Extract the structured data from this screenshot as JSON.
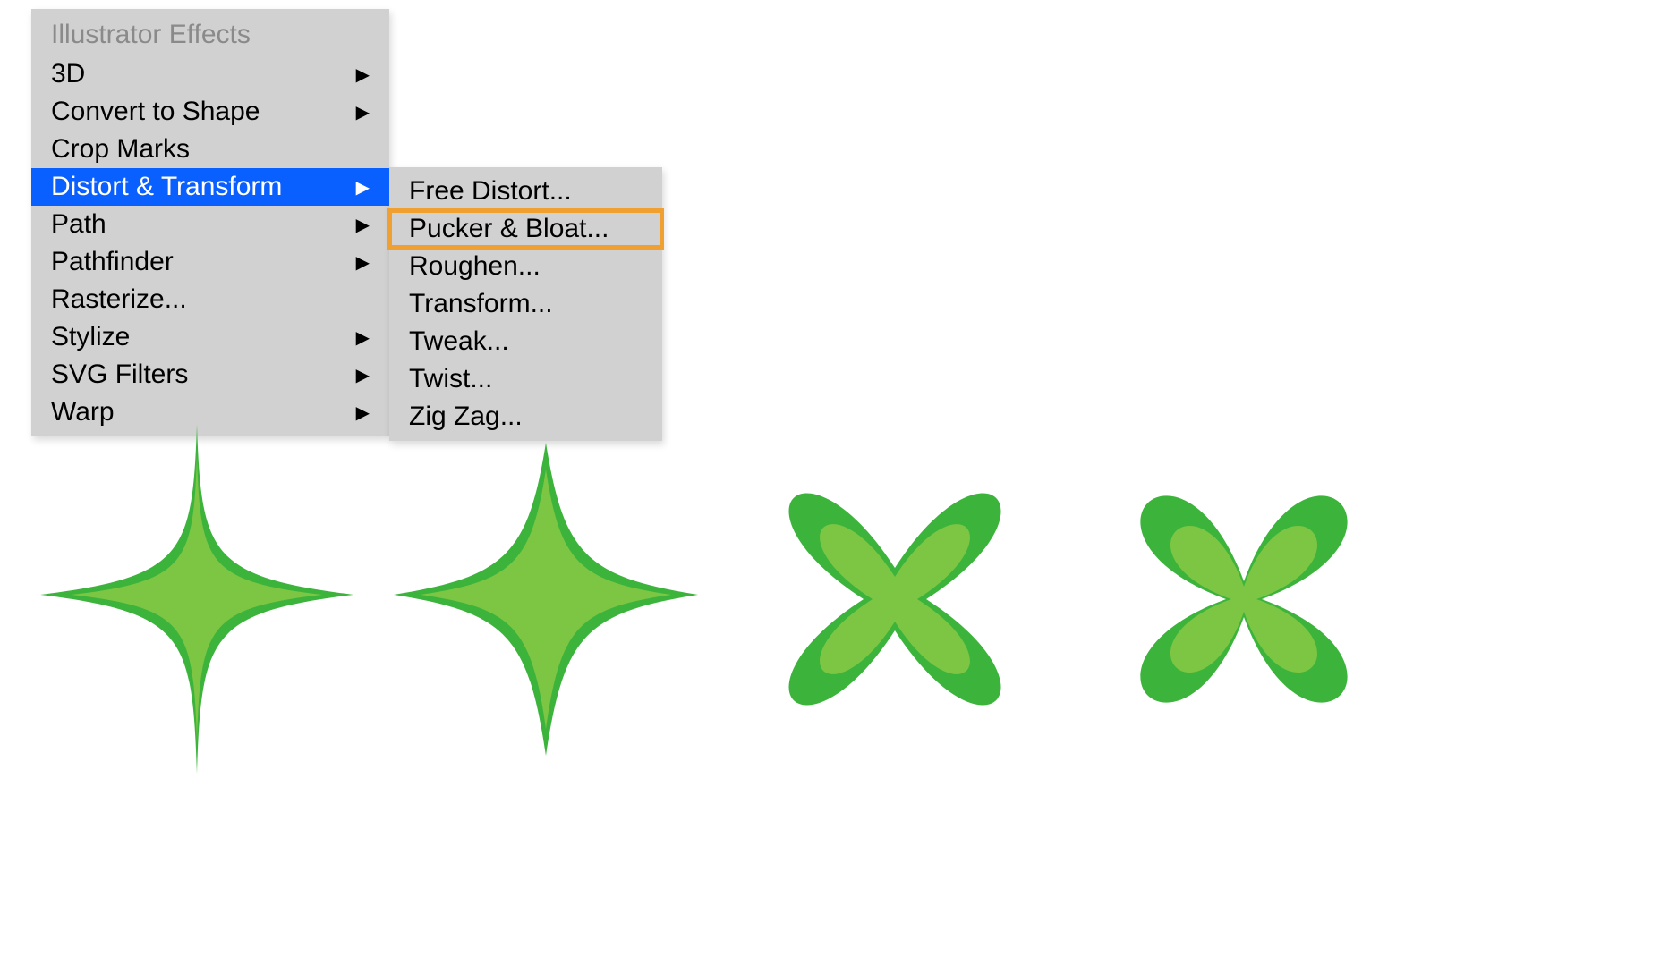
{
  "menu": {
    "header": "Illustrator Effects",
    "primary_items": [
      {
        "label": "3D",
        "has_submenu": true,
        "highlighted": false
      },
      {
        "label": "Convert to Shape",
        "has_submenu": true,
        "highlighted": false
      },
      {
        "label": "Crop Marks",
        "has_submenu": false,
        "highlighted": false
      },
      {
        "label": "Distort & Transform",
        "has_submenu": true,
        "highlighted": true
      },
      {
        "label": "Path",
        "has_submenu": true,
        "highlighted": false
      },
      {
        "label": "Pathfinder",
        "has_submenu": true,
        "highlighted": false
      },
      {
        "label": "Rasterize...",
        "has_submenu": false,
        "highlighted": false
      },
      {
        "label": "Stylize",
        "has_submenu": true,
        "highlighted": false
      },
      {
        "label": "SVG Filters",
        "has_submenu": true,
        "highlighted": false
      },
      {
        "label": "Warp",
        "has_submenu": true,
        "highlighted": false
      }
    ],
    "secondary_items": [
      {
        "label": "Free Distort...",
        "boxed": false
      },
      {
        "label": "Pucker & Bloat...",
        "boxed": true
      },
      {
        "label": "Roughen...",
        "boxed": false
      },
      {
        "label": "Transform...",
        "boxed": false
      },
      {
        "label": "Tweak...",
        "boxed": false
      },
      {
        "label": "Twist...",
        "boxed": false
      },
      {
        "label": "Zig Zag...",
        "boxed": false
      }
    ]
  },
  "colors": {
    "menu_bg": "#d1d1d1",
    "highlight": "#0a5fff",
    "box_outline": "#f0a030",
    "shape_outer": "#3cb43c",
    "shape_inner": "#7cc644"
  },
  "shapes": [
    {
      "type": "pucker-strong",
      "description": "Four-point star, very concave sides"
    },
    {
      "type": "pucker-mild",
      "description": "Four-point star, moderately concave sides"
    },
    {
      "type": "bloat-mild",
      "description": "Four-lobe clover, rounded convex petals"
    },
    {
      "type": "bloat-strong",
      "description": "Four-lobe clover rotated, elongated petals"
    }
  ]
}
